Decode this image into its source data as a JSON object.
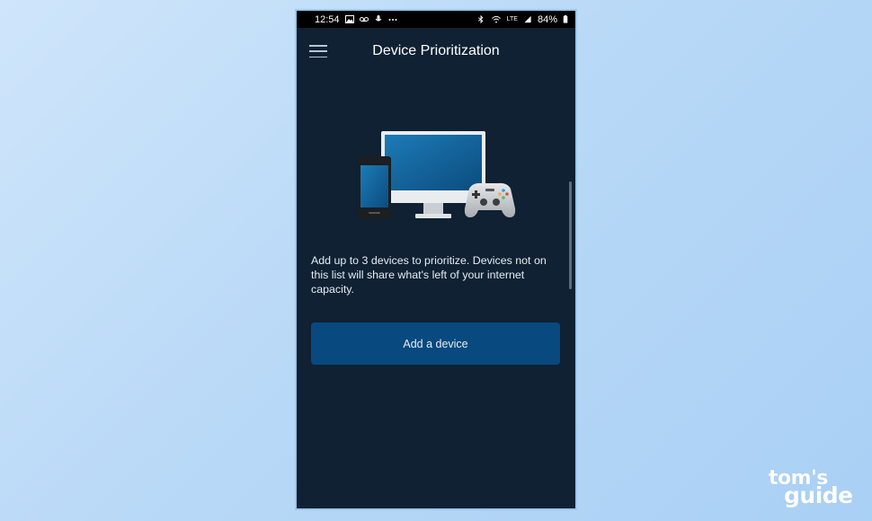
{
  "status_bar": {
    "time": "12:54",
    "network": "LTE",
    "battery": "84%",
    "left_icons": [
      "image-icon",
      "voicemail-icon",
      "mic-icon",
      "more-dots-icon"
    ],
    "right_icons": [
      "bluetooth-icon",
      "wifi-icon",
      "signal-icon",
      "battery-icon"
    ]
  },
  "app_bar": {
    "title": "Device Prioritization",
    "menu_icon": "hamburger-menu-icon"
  },
  "illustration": {
    "icons": [
      "phone-icon",
      "monitor-icon",
      "game-controller-icon"
    ]
  },
  "main": {
    "description": "Add up to 3 devices to prioritize. Devices not on this list will share what's left of your internet capacity.",
    "add_button_label": "Add a device"
  },
  "watermark": {
    "line1": "tom's",
    "line2": "guide"
  },
  "colors": {
    "screen_bg": "#0f2132",
    "button_bg": "#08497f",
    "page_bg": "#b9d9f7"
  }
}
